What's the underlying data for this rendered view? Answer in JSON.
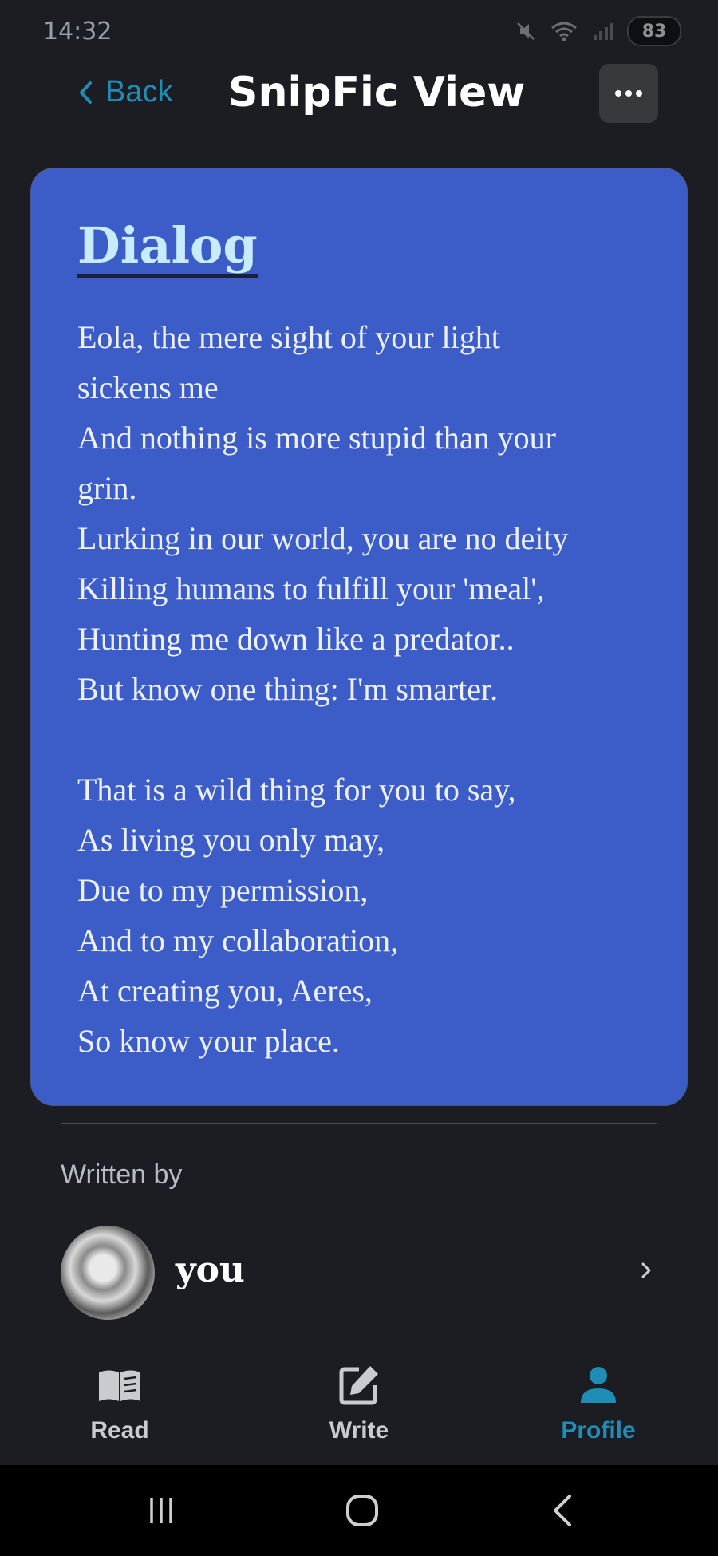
{
  "status": {
    "time": "14:32",
    "battery": "83"
  },
  "header": {
    "back_label": "Back",
    "title": "SnipFic View"
  },
  "card": {
    "title": "Dialog",
    "lines": [
      "Eola, the mere sight of your light",
      "sickens me",
      "And nothing is more stupid than your",
      "grin.",
      "Lurking in our world, you are no deity",
      "Killing humans to fulfill your 'meal',",
      "Hunting me down like a predator..",
      "But know one thing: I'm smarter.",
      "",
      "That is a wild thing for you to say,",
      "As living you only may,",
      "Due to my permission,",
      "And to my collaboration,",
      "At creating you, Aeres,",
      "So know your place."
    ],
    "background_color": "#3c5dc8",
    "title_color": "#c8ecff"
  },
  "author_section": {
    "label": "Written by",
    "name": "you"
  },
  "nav": {
    "items": [
      {
        "label": "Read",
        "icon": "book-icon",
        "active": false
      },
      {
        "label": "Write",
        "icon": "edit-icon",
        "active": false
      },
      {
        "label": "Profile",
        "icon": "person-icon",
        "active": true
      }
    ],
    "active_color": "#1f8db6"
  }
}
